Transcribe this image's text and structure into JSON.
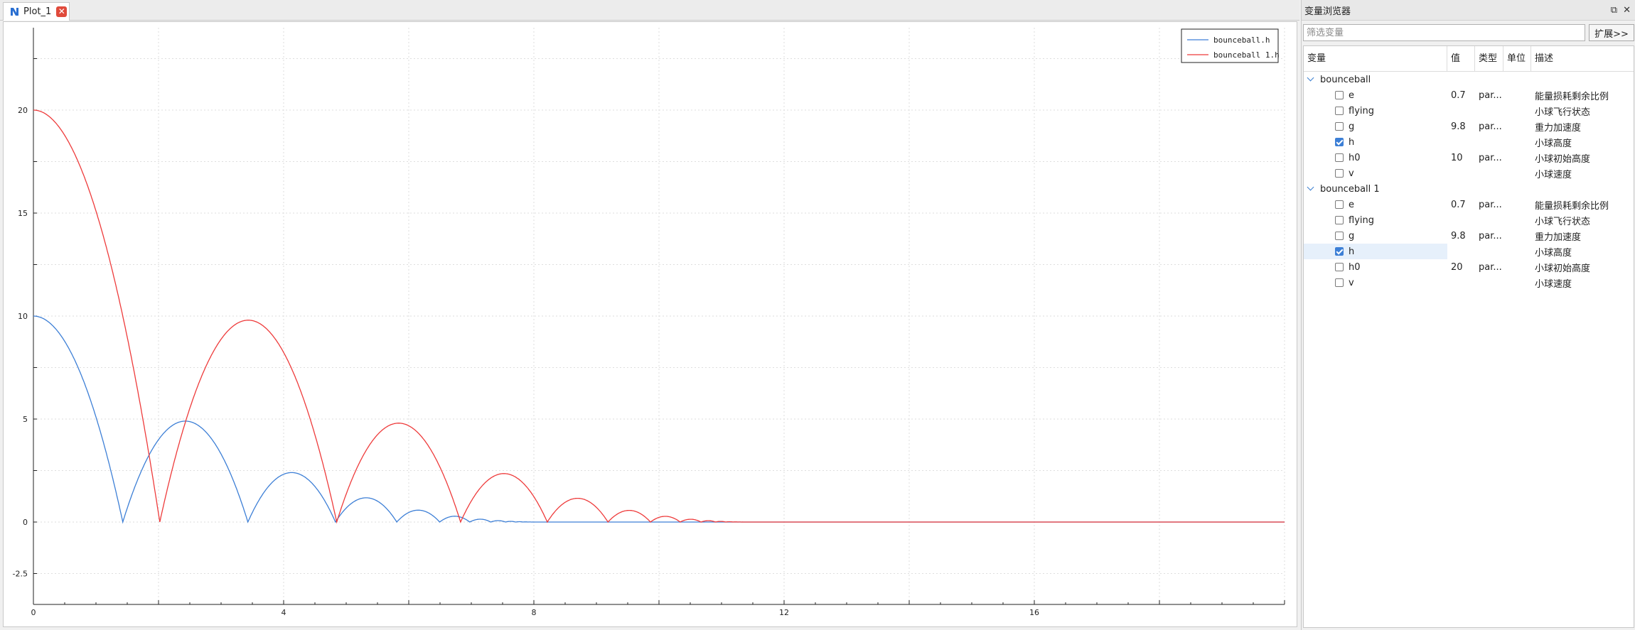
{
  "tab": {
    "title": "Plot_1",
    "close_symbol": "✕"
  },
  "panel": {
    "title": "变量浏览器",
    "float_symbol": "⧉",
    "close_symbol": "✕",
    "filter_placeholder": "筛选变量",
    "expand_label": "扩展>>",
    "columns": [
      "变量",
      "值",
      "类型",
      "单位",
      "描述"
    ],
    "groups": [
      {
        "name": "bounceball",
        "items": [
          {
            "name": "e",
            "value": "0.7",
            "type": "par...",
            "unit": "",
            "desc": "能量损耗剩余比例",
            "checked": false
          },
          {
            "name": "flying",
            "value": "",
            "type": "",
            "unit": "",
            "desc": "小球飞行状态",
            "checked": false
          },
          {
            "name": "g",
            "value": "9.8",
            "type": "par...",
            "unit": "",
            "desc": "重力加速度",
            "checked": false
          },
          {
            "name": "h",
            "value": "",
            "type": "",
            "unit": "",
            "desc": "小球高度",
            "checked": true
          },
          {
            "name": "h0",
            "value": "10",
            "type": "par...",
            "unit": "",
            "desc": "小球初始高度",
            "checked": false
          },
          {
            "name": "v",
            "value": "",
            "type": "",
            "unit": "",
            "desc": "小球速度",
            "checked": false
          }
        ]
      },
      {
        "name": "bounceball 1",
        "items": [
          {
            "name": "e",
            "value": "0.7",
            "type": "par...",
            "unit": "",
            "desc": "能量损耗剩余比例",
            "checked": false
          },
          {
            "name": "flying",
            "value": "",
            "type": "",
            "unit": "",
            "desc": "小球飞行状态",
            "checked": false
          },
          {
            "name": "g",
            "value": "9.8",
            "type": "par...",
            "unit": "",
            "desc": "重力加速度",
            "checked": false
          },
          {
            "name": "h",
            "value": "",
            "type": "",
            "unit": "",
            "desc": "小球高度",
            "checked": true,
            "selected": true
          },
          {
            "name": "h0",
            "value": "20",
            "type": "par...",
            "unit": "",
            "desc": "小球初始高度",
            "checked": false
          },
          {
            "name": "v",
            "value": "",
            "type": "",
            "unit": "",
            "desc": "小球速度",
            "checked": false
          }
        ]
      }
    ]
  },
  "colors": {
    "series1": "#3d7fd6",
    "series2": "#ee3b3b",
    "accent": "#3c7fd6",
    "tab_close": "#e04a3b"
  },
  "chart_data": {
    "type": "line",
    "title": "",
    "xlabel": "",
    "ylabel": "",
    "xlim": [
      0,
      20
    ],
    "ylim": [
      -4,
      24
    ],
    "xticks": [
      0,
      4,
      8,
      12,
      16
    ],
    "yticks": [
      -2.5,
      0,
      5,
      10,
      15,
      20
    ],
    "grid": true,
    "legend_position": "top-right",
    "series": [
      {
        "name": "bounceball.h",
        "color": "#3d7fd6",
        "h0": 10,
        "g": 9.8,
        "e": 0.7
      },
      {
        "name": "bounceball 1.h",
        "color": "#ee3b3b",
        "h0": 20,
        "g": 9.8,
        "e": 0.7
      }
    ]
  }
}
